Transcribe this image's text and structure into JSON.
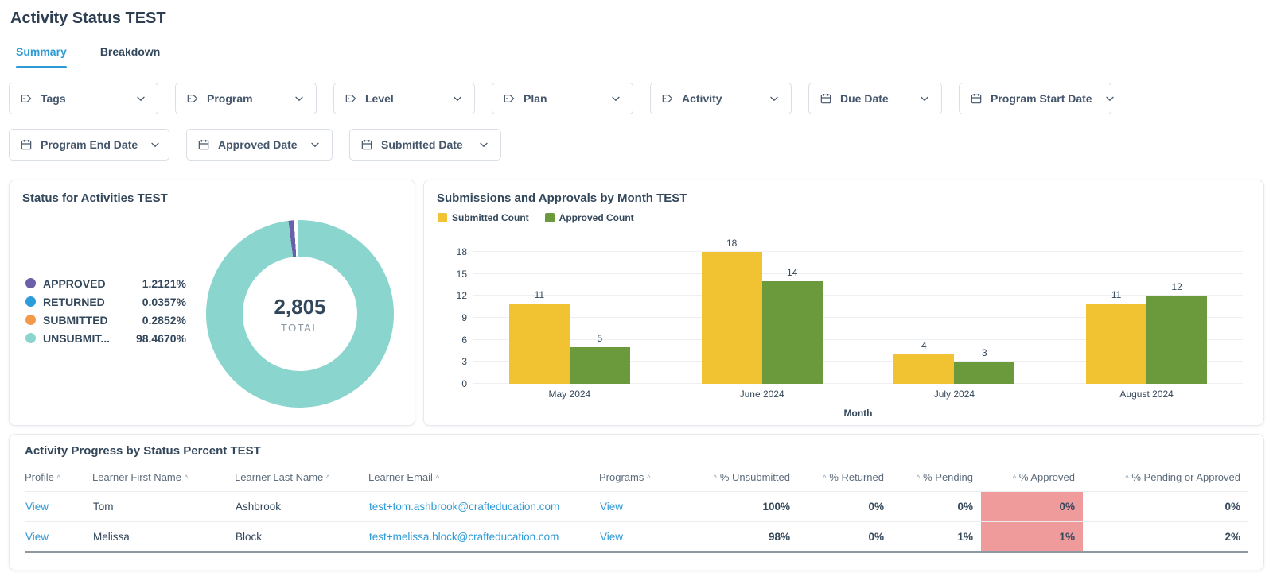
{
  "page": {
    "title": "Activity Status TEST"
  },
  "colors": {
    "accent": "#2e9ad6",
    "highlight": "#f09b9b"
  },
  "tabs": [
    {
      "label": "Summary",
      "active": true
    },
    {
      "label": "Breakdown",
      "active": false
    }
  ],
  "filters": {
    "row1": [
      {
        "label": "Tags",
        "icon": "tag"
      },
      {
        "label": "Program",
        "icon": "tag"
      },
      {
        "label": "Level",
        "icon": "tag"
      },
      {
        "label": "Plan",
        "icon": "tag"
      },
      {
        "label": "Activity",
        "icon": "tag"
      },
      {
        "label": "Due Date",
        "icon": "calendar"
      },
      {
        "label": "Program Start Date",
        "icon": "calendar"
      }
    ],
    "row2": [
      {
        "label": "Program End Date",
        "icon": "calendar"
      },
      {
        "label": "Approved Date",
        "icon": "calendar"
      },
      {
        "label": "Submitted Date",
        "icon": "calendar"
      }
    ]
  },
  "donut_card": {
    "title": "Status for Activities TEST",
    "total_value": "2,805",
    "total_label": "TOTAL"
  },
  "bar_card": {
    "title": "Submissions and Approvals by Month TEST",
    "xlabel": "Month"
  },
  "table_card": {
    "title": "Activity Progress by Status Percent TEST",
    "link_columns": [
      0,
      3,
      4
    ],
    "highlight_column": 8,
    "columns": [
      {
        "label": "Profile",
        "align": "left",
        "caret": "after"
      },
      {
        "label": "Learner First Name",
        "align": "left",
        "caret": "after"
      },
      {
        "label": "Learner Last Name",
        "align": "left",
        "caret": "after"
      },
      {
        "label": "Learner Email",
        "align": "left",
        "caret": "after"
      },
      {
        "label": "Programs",
        "align": "left",
        "caret": "after"
      },
      {
        "label": "% Unsubmitted",
        "align": "right",
        "caret": "before"
      },
      {
        "label": "% Returned",
        "align": "right",
        "caret": "before"
      },
      {
        "label": "% Pending",
        "align": "right",
        "caret": "before"
      },
      {
        "label": "% Approved",
        "align": "right",
        "caret": "before"
      },
      {
        "label": "% Pending or Approved",
        "align": "right",
        "caret": "before"
      }
    ],
    "rows": [
      {
        "cells": [
          "View",
          "Tom",
          "Ashbrook",
          "test+tom.ashbrook@crafteducation.com",
          "View",
          "100%",
          "0%",
          "0%",
          "0%",
          "0%"
        ]
      },
      {
        "cells": [
          "View",
          "Melissa",
          "Block",
          "test+melissa.block@crafteducation.com",
          "View",
          "98%",
          "0%",
          "1%",
          "1%",
          "2%"
        ]
      }
    ]
  },
  "chart_data": [
    {
      "type": "pie",
      "title": "Status for Activities TEST",
      "labels": [
        "APPROVED",
        "RETURNED",
        "SUBMITTED",
        "UNSUBMIT..."
      ],
      "values": [
        1.2121,
        0.0357,
        0.2852,
        98.467
      ],
      "value_labels": [
        "1.2121%",
        "0.0357%",
        "0.2852%",
        "98.4670%"
      ],
      "colors": [
        "#6a5fa8",
        "#2d9cdb",
        "#f2994a",
        "#8ad5ce"
      ],
      "center_total": "2,805",
      "center_label": "TOTAL",
      "legend_position": "left"
    },
    {
      "type": "bar",
      "title": "Submissions and Approvals by Month TEST",
      "categories": [
        "May 2024",
        "June 2024",
        "July 2024",
        "August 2024"
      ],
      "series": [
        {
          "name": "Submitted Count",
          "color": "#f1c232",
          "values": [
            11,
            18,
            4,
            11
          ]
        },
        {
          "name": "Approved Count",
          "color": "#6a9a3b",
          "values": [
            5,
            14,
            3,
            12
          ]
        }
      ],
      "xlabel": "Month",
      "ylabel": "",
      "ylim": [
        0,
        18
      ],
      "yticks": [
        0,
        3,
        6,
        9,
        12,
        15,
        18
      ],
      "grid": true,
      "legend_position": "top-left"
    }
  ]
}
